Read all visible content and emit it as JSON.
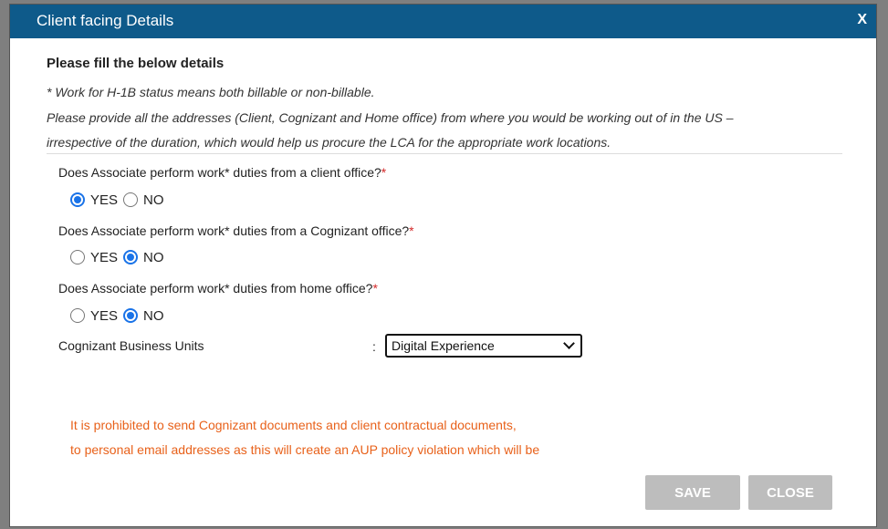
{
  "dialog": {
    "title": "Client facing Details",
    "close_label": "X"
  },
  "form": {
    "heading": "Please fill the below details",
    "note_line1": "* Work for H-1B status means both billable or non-billable.",
    "note_line2": "Please provide all the addresses (Client, Cognizant and Home office) from where you would be working out of in the US –",
    "note_line3": "irrespective of the duration, which would help us procure the LCA for the appropriate work locations.",
    "questions": [
      {
        "text": "Does Associate perform work* duties from a client office?",
        "required": "*",
        "yes_label": "YES",
        "no_label": "NO",
        "selected": "YES"
      },
      {
        "text": "Does Associate perform work* duties from a Cognizant office?",
        "required": "*",
        "yes_label": "YES",
        "no_label": "NO",
        "selected": "NO"
      },
      {
        "text": "Does Associate perform work* duties from home office?",
        "required": "*",
        "yes_label": "YES",
        "no_label": "NO",
        "selected": "NO"
      }
    ],
    "business_units_label": "Cognizant Business Units",
    "colon": ":",
    "business_units_value": "Digital Experience"
  },
  "warning": {
    "line1": "It is prohibited to send Cognizant documents and client contractual documents,",
    "line2": "to personal email addresses as this will create an AUP policy violation which will be"
  },
  "buttons": {
    "save": "SAVE",
    "close": "CLOSE"
  },
  "colors": {
    "titlebar": "#0e5a8a",
    "warning": "#e8611a",
    "required": "#d42a2a",
    "button": "#bdbdbd",
    "radio_selected": "#1a73e8"
  }
}
